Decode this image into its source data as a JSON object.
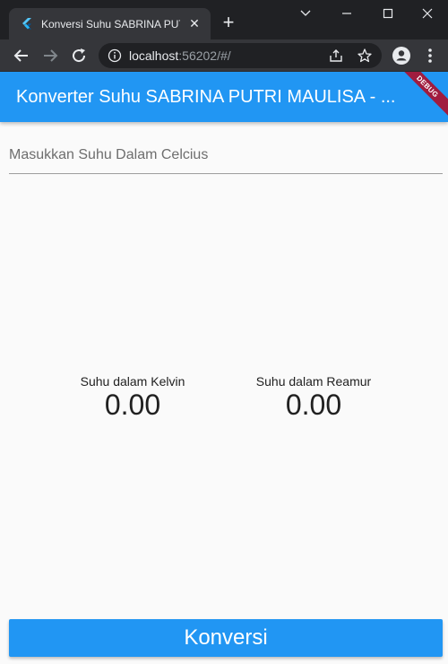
{
  "browser": {
    "tab_title": "Konversi Suhu SABRINA PUTRI MAULISA",
    "url_host": "localhost",
    "url_rest": ":56202/#/"
  },
  "app": {
    "title": "Konverter Suhu SABRINA PUTRI MAULISA - ...",
    "debug_banner": "DEBUG",
    "input": {
      "placeholder": "Masukkan Suhu Dalam Celcius",
      "value": ""
    },
    "results": {
      "kelvin": {
        "label": "Suhu dalam Kelvin",
        "value": "0.00"
      },
      "reamur": {
        "label": "Suhu dalam Reamur",
        "value": "0.00"
      }
    },
    "convert_label": "Konversi"
  },
  "colors": {
    "primary": "#2196f3",
    "debug_banner": "#a01c3f",
    "chrome_dark": "#202124",
    "chrome_toolbar": "#35363a"
  },
  "icons": [
    "flutter-icon",
    "close-icon",
    "plus-icon",
    "chevron-down-icon",
    "minimize-icon",
    "maximize-icon",
    "close-window-icon",
    "back-arrow-icon",
    "forward-arrow-icon",
    "reload-icon",
    "info-icon",
    "share-icon",
    "star-icon",
    "profile-icon",
    "more-vert-icon"
  ]
}
